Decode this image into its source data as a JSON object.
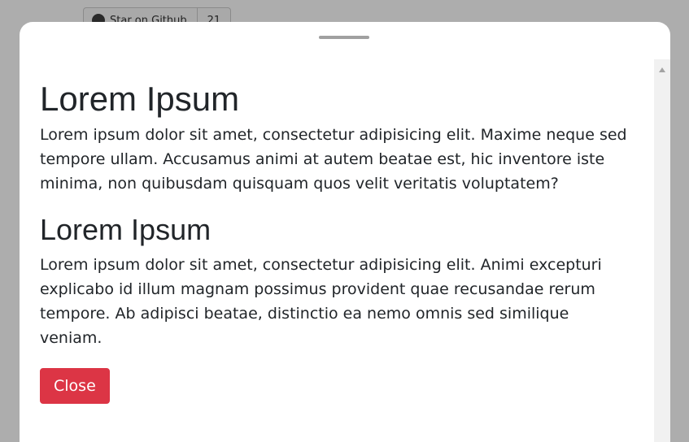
{
  "background": {
    "github_button": {
      "label": "Star on Github",
      "count": "21"
    }
  },
  "sheet": {
    "sections": [
      {
        "heading": "Lorem Ipsum",
        "body": "Lorem ipsum dolor sit amet, consectetur adipisicing elit. Maxime neque sed tempore ullam. Accusamus animi at autem beatae est, hic inventore iste minima, non quibusdam quisquam quos velit veritatis voluptatem?"
      },
      {
        "heading": "Lorem Ipsum",
        "body": "Lorem ipsum dolor sit amet, consectetur adipisicing elit. Animi excepturi explicabo id illum magnam possimus provident quae recusandae rerum tempore. Ab adipisci beatae, distinctio ea nemo omnis sed similique veniam."
      }
    ],
    "close_label": "Close"
  },
  "colors": {
    "overlay": "#adadad",
    "sheet_bg": "#ffffff",
    "close_button": "#dc3545",
    "text": "#212529"
  }
}
